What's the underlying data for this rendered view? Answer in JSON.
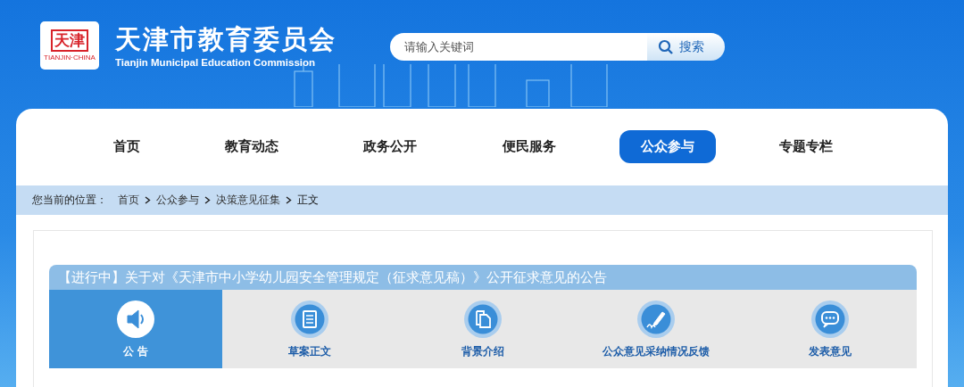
{
  "header": {
    "logo": {
      "seal": "天津",
      "caption": "TIANJIN·CHINA"
    },
    "title": "天津市教育委员会",
    "subtitle": "Tianjin Municipal Education Commission",
    "search": {
      "placeholder": "请输入关键词",
      "button": "搜索"
    }
  },
  "nav": [
    {
      "label": "首页",
      "selected": false
    },
    {
      "label": "教育动态",
      "selected": false
    },
    {
      "label": "政务公开",
      "selected": false
    },
    {
      "label": "便民服务",
      "selected": false
    },
    {
      "label": "公众参与",
      "selected": true
    },
    {
      "label": "专题专栏",
      "selected": false
    }
  ],
  "breadcrumb": {
    "label": "您当前的位置：",
    "items": [
      "首页",
      "公众参与",
      "决策意见征集",
      "正文"
    ]
  },
  "notice": {
    "title": "【进行中】关于对《天津市中小学幼儿园安全管理规定（征求意见稿）》公开征求意见的公告",
    "tabs": [
      {
        "label": "公 告",
        "kind": "speaker",
        "selected": true
      },
      {
        "label": "草案正文",
        "kind": "document",
        "selected": false
      },
      {
        "label": "背景介绍",
        "kind": "copies",
        "selected": false
      },
      {
        "label": "公众意见采纳情况反馈",
        "kind": "pen",
        "selected": false
      },
      {
        "label": "发表意见",
        "kind": "chat",
        "selected": false
      }
    ]
  }
}
